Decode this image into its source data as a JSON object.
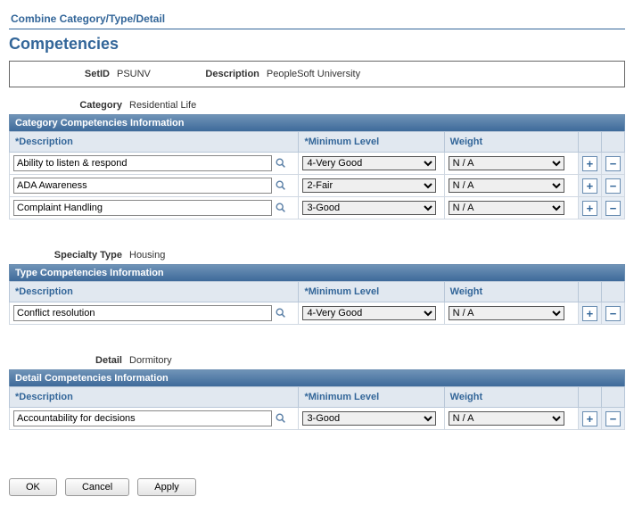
{
  "tab": "Combine Category/Type/Detail",
  "page_title": "Competencies",
  "header": {
    "setid_label": "SetID",
    "setid_value": "PSUNV",
    "description_label": "Description",
    "description_value": "PeopleSoft University"
  },
  "columns": {
    "description": "*Description",
    "minimum_level": "*Minimum Level",
    "weight": "Weight"
  },
  "icons": {
    "add_text": "+",
    "delete_text": "−"
  },
  "sections": [
    {
      "context_label": "Category",
      "context_value": "Residential Life",
      "grid_title": "Category Competencies Information",
      "rows": [
        {
          "description": "Ability to listen & respond",
          "level": "4-Very Good",
          "weight": "N / A"
        },
        {
          "description": "ADA Awareness",
          "level": "2-Fair",
          "weight": "N / A"
        },
        {
          "description": "Complaint Handling",
          "level": "3-Good",
          "weight": "N / A"
        }
      ]
    },
    {
      "context_label": "Specialty Type",
      "context_value": "Housing",
      "grid_title": "Type Competencies Information",
      "rows": [
        {
          "description": "Conflict resolution",
          "level": "4-Very Good",
          "weight": "N / A"
        }
      ]
    },
    {
      "context_label": "Detail",
      "context_value": "Dormitory",
      "grid_title": "Detail Competencies Information",
      "rows": [
        {
          "description": "Accountability for decisions",
          "level": "3-Good",
          "weight": "N / A"
        }
      ]
    }
  ],
  "buttons": {
    "ok": "OK",
    "cancel": "Cancel",
    "apply": "Apply"
  }
}
